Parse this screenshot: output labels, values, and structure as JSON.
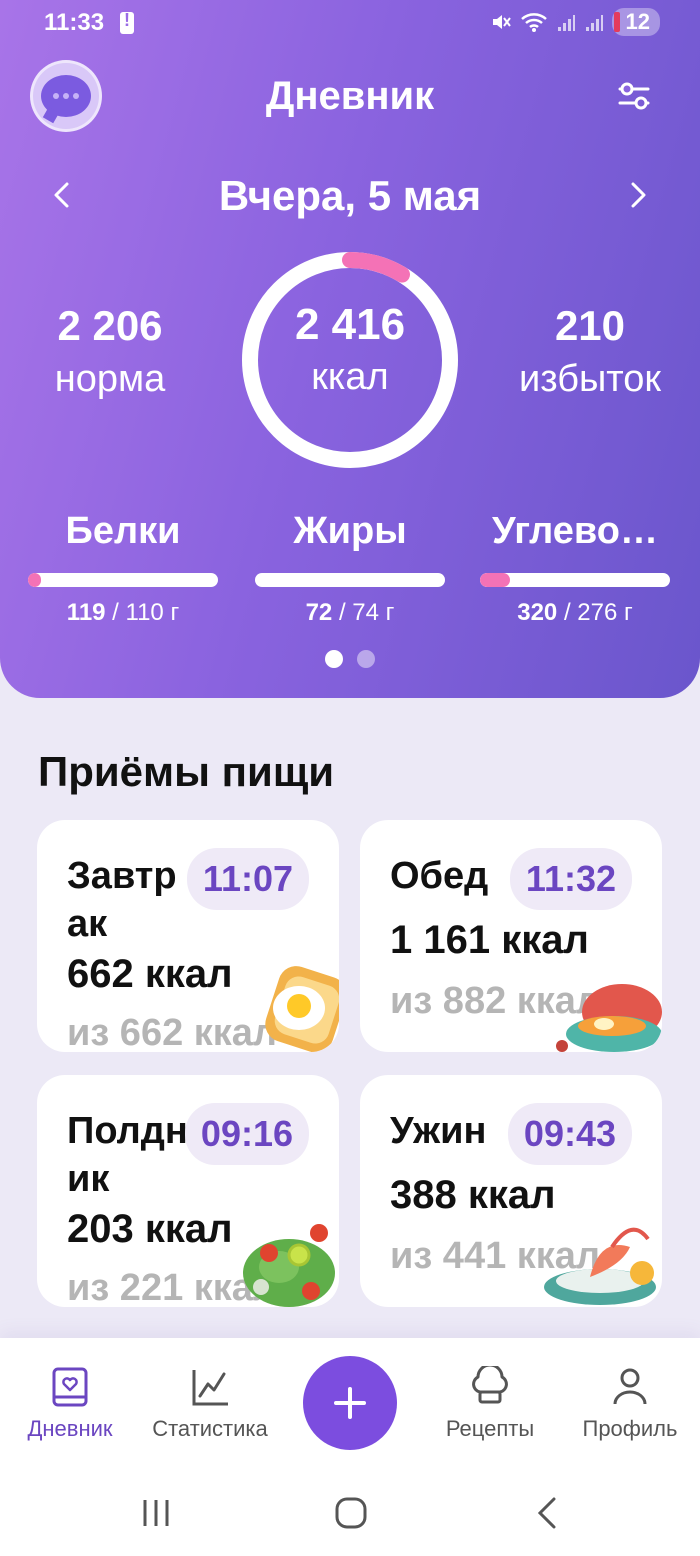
{
  "status": {
    "time": "11:33",
    "battery": "12"
  },
  "header": {
    "title": "Дневник"
  },
  "date": {
    "label": "Вчера,  5 мая"
  },
  "summary": {
    "norm_value": "2 206",
    "norm_label": "норма",
    "eaten_value": "2 416",
    "eaten_label": "ккал",
    "over_value": "210",
    "over_label": "избыток",
    "ring_fraction": 0.087
  },
  "macros": [
    {
      "name": "Белки",
      "eaten": "119",
      "rest": " / 110 г",
      "fill": 0.07
    },
    {
      "name": "Жиры",
      "eaten": "72",
      "rest": " / 74 г",
      "fill": 0.0
    },
    {
      "name": "Углево…",
      "eaten": "320",
      "rest": " / 276 г",
      "fill": 0.16
    }
  ],
  "pager": {
    "pages": 2,
    "active": 0
  },
  "meals": {
    "title": "Приёмы пищи",
    "items": [
      {
        "name": "Завтрак",
        "time": "11:07",
        "kcal": "662 ккал",
        "of": "из 662 ккал",
        "icon": "toast-egg-icon"
      },
      {
        "name": "Обед",
        "time": "11:32",
        "kcal": "1 161 ккал",
        "of": "из 882 ккал",
        "icon": "lunch-bowl-icon"
      },
      {
        "name": "Полдник",
        "time": "09:16",
        "kcal": "203 ккал",
        "of": "из 221 ккал",
        "icon": "salad-icon"
      },
      {
        "name": "Ужин",
        "time": "09:43",
        "kcal": "388 ккал",
        "of": "из 441 ккал",
        "icon": "shrimp-plate-icon"
      }
    ]
  },
  "nav": {
    "diary": "Дневник",
    "stats": "Статистика",
    "recipes": "Рецепты",
    "profile": "Профиль"
  },
  "colors": {
    "accent": "#7c4ddf",
    "pink": "#f472b6"
  }
}
